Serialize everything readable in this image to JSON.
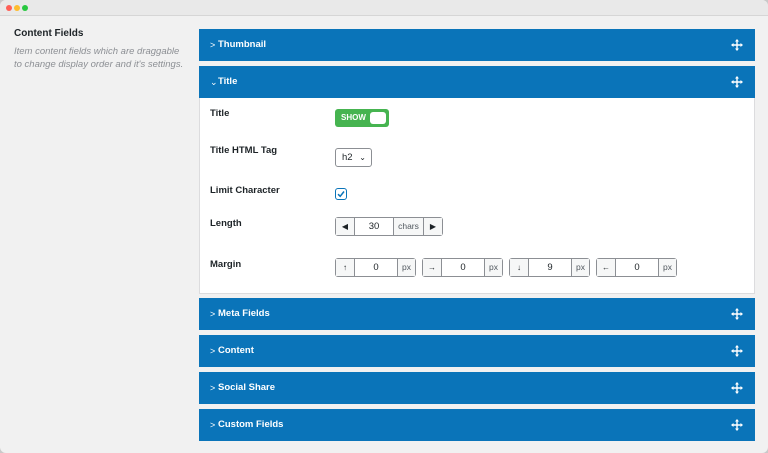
{
  "settings": {
    "title": "Content Fields",
    "description": "Item content fields which are draggable to change display order and it's settings."
  },
  "panels": [
    {
      "label": "Thumbnail",
      "chevron": ">",
      "expanded": false
    },
    {
      "label": "Title",
      "chevron": "⌄",
      "expanded": true
    },
    {
      "label": "Meta Fields",
      "chevron": ">",
      "expanded": false
    },
    {
      "label": "Content",
      "chevron": ">",
      "expanded": false
    },
    {
      "label": "Social Share",
      "chevron": ">",
      "expanded": false
    },
    {
      "label": "Custom Fields",
      "chevron": ">",
      "expanded": false
    }
  ],
  "title_panel": {
    "title_label": "Title",
    "toggle_text": "SHOW",
    "toggle_on": true,
    "tag_label": "Title HTML Tag",
    "tag_value": "h2",
    "tag_arrow": "⌄",
    "limit_label": "Limit Character",
    "limit_checked": true,
    "length_label": "Length",
    "length_dec": "◀",
    "length_value": "30",
    "length_unit": "chars",
    "length_inc": "▶",
    "margin_label": "Margin",
    "margin": [
      {
        "arrow": "↑",
        "value": "0",
        "unit": "px"
      },
      {
        "arrow": "→",
        "value": "0",
        "unit": "px"
      },
      {
        "arrow": "↓",
        "value": "9",
        "unit": "px"
      },
      {
        "arrow": "←",
        "value": "0",
        "unit": "px"
      }
    ]
  },
  "colors": {
    "accent": "#0a74b9",
    "toggle": "#46b450"
  },
  "icons": {
    "move": "move-icon",
    "check": "check-icon"
  }
}
